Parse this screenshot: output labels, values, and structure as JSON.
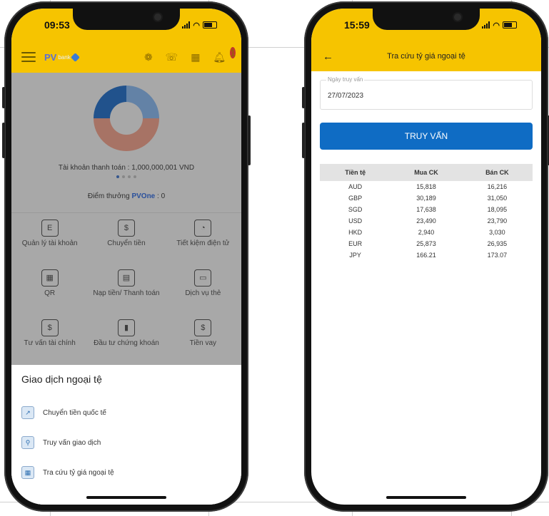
{
  "left_phone": {
    "status": {
      "time": "09:53"
    },
    "appbar": {
      "logo_text": "PV",
      "logo_sub": "bank",
      "notification_count": "1"
    },
    "chart_data": {
      "type": "pie",
      "values": [
        25,
        50,
        25
      ],
      "colors": [
        "#8ab4e6",
        "#e8a08c",
        "#2f72c2"
      ]
    },
    "account_line": "Tài khoản thanh toán : 1,000,000,001 VND",
    "points": {
      "prefix": "Điểm thưởng",
      "brand": "PVOne",
      "value": ": 0"
    },
    "tiles": [
      {
        "label": "Quản lý tài khoản",
        "icon": "wallet-icon"
      },
      {
        "label": "Chuyển tiền",
        "icon": "money-transfer-icon"
      },
      {
        "label": "Tiết kiệm điện tử",
        "icon": "piggy-bank-icon"
      },
      {
        "label": "QR",
        "icon": "qr-icon"
      },
      {
        "label": "Nạp tiền/ Thanh toán",
        "icon": "payment-icon"
      },
      {
        "label": "Dịch vụ thẻ",
        "icon": "card-icon"
      },
      {
        "label": "Tư vấn tài chính",
        "icon": "calendar-icon"
      },
      {
        "label": "Đầu tư chứng khoán",
        "icon": "chart-icon"
      },
      {
        "label": "Tiền vay",
        "icon": "loan-icon"
      }
    ],
    "sheet": {
      "title": "Giao dịch ngoại tệ",
      "items": [
        {
          "label": "Chuyển tiền quốc tế"
        },
        {
          "label": "Truy vấn giao dịch"
        },
        {
          "label": "Tra cứu tỷ giá ngoại tệ"
        }
      ]
    }
  },
  "right_phone": {
    "status": {
      "time": "15:59"
    },
    "header_title": "Tra cứu tỷ giá ngoại tệ",
    "date_field": {
      "label": "Ngày truy vấn",
      "value": "27/07/2023"
    },
    "submit_label": "TRUY VẤN",
    "table": {
      "headers": [
        "Tiền tệ",
        "Mua CK",
        "Bán CK"
      ],
      "rows": [
        [
          "AUD",
          "15,818",
          "16,216"
        ],
        [
          "GBP",
          "30,189",
          "31,050"
        ],
        [
          "SGD",
          "17,638",
          "18,095"
        ],
        [
          "USD",
          "23,490",
          "23,790"
        ],
        [
          "HKD",
          "2,940",
          "3,030"
        ],
        [
          "EUR",
          "25,873",
          "26,935"
        ],
        [
          "JPY",
          "166.21",
          "173.07"
        ]
      ]
    }
  }
}
